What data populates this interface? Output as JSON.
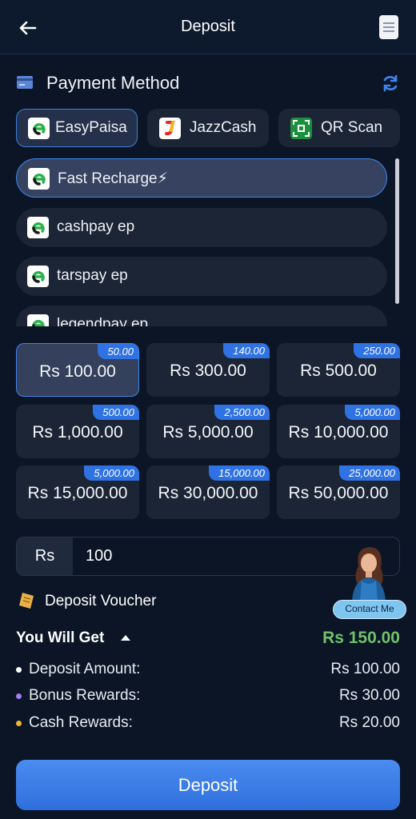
{
  "header": {
    "title": "Deposit",
    "back_icon": "arrow-left-icon",
    "menu_icon": "document-menu-icon"
  },
  "payment": {
    "title": "Payment Method",
    "methods": [
      {
        "label": "EasyPaisa",
        "icon": "easypaisa-logo",
        "active": true
      },
      {
        "label": "JazzCash",
        "icon": "jazzcash-logo",
        "active": false
      },
      {
        "label": "QR Scan",
        "icon": "qr-scan-logo",
        "active": false
      }
    ],
    "channels": [
      {
        "label": "Fast Recharge⚡",
        "active": true
      },
      {
        "label": "cashpay ep",
        "active": false
      },
      {
        "label": "tarspay ep",
        "active": false
      },
      {
        "label": "legendpay ep",
        "active": false
      }
    ]
  },
  "amounts": [
    {
      "value": "Rs 100.00",
      "bonus": "50.00",
      "active": true
    },
    {
      "value": "Rs 300.00",
      "bonus": "140.00",
      "active": false
    },
    {
      "value": "Rs 500.00",
      "bonus": "250.00",
      "active": false
    },
    {
      "value": "Rs 1,000.00",
      "bonus": "500.00",
      "active": false
    },
    {
      "value": "Rs 5,000.00",
      "bonus": "2,500.00",
      "active": false
    },
    {
      "value": "Rs 10,000.00",
      "bonus": "5,000.00",
      "active": false
    },
    {
      "value": "Rs 15,000.00",
      "bonus": "5,000.00",
      "active": false
    },
    {
      "value": "Rs 30,000.00",
      "bonus": "15,000.00",
      "active": false
    },
    {
      "value": "Rs 50,000.00",
      "bonus": "25,000.00",
      "active": false
    }
  ],
  "input": {
    "prefix": "Rs",
    "value": "100"
  },
  "contact": {
    "label": "Contact Me"
  },
  "voucher": {
    "label": "Deposit Voucher"
  },
  "summary": {
    "label": "You Will Get",
    "total": "Rs 150.00",
    "rows": [
      {
        "label": "Deposit Amount:",
        "value": "Rs 100.00",
        "dot_color": "#ffffff"
      },
      {
        "label": "Bonus Rewards:",
        "value": "Rs 30.00",
        "dot_color": "#a77cf0"
      },
      {
        "label": "Cash Rewards:",
        "value": "Rs 20.00",
        "dot_color": "#f3b43a"
      }
    ]
  },
  "action": {
    "label": "Deposit"
  },
  "colors": {
    "accent": "#3f86ea",
    "success": "#6fc36a",
    "background": "#0b1526"
  }
}
